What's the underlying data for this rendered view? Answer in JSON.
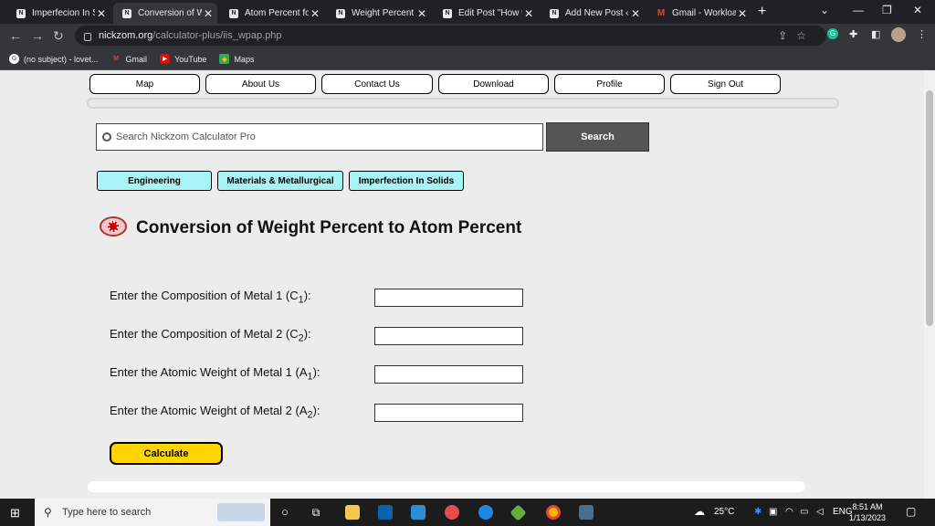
{
  "browser": {
    "tabs": [
      {
        "title": "Imperfecion In So",
        "active": false
      },
      {
        "title": "Conversion of We",
        "active": true
      },
      {
        "title": "Atom Percent for",
        "active": false
      },
      {
        "title": "Weight Percent fr",
        "active": false
      },
      {
        "title": "Edit Post \"How to",
        "active": false
      },
      {
        "title": "Add New Post ‹ N",
        "active": false
      },
      {
        "title": "Gmail - Workloac",
        "active": false
      }
    ],
    "url_host": "nickzom.org",
    "url_path": "/calculator-plus/iis_wpap.php",
    "bookmarks": [
      {
        "label": "(no subject) - lovet...",
        "icon": "google-icon"
      },
      {
        "label": "Gmail",
        "icon": "gmail-icon"
      },
      {
        "label": "YouTube",
        "icon": "youtube-icon"
      },
      {
        "label": "Maps",
        "icon": "maps-icon"
      }
    ]
  },
  "menu": [
    "Map",
    "About Us",
    "Contact Us",
    "Download",
    "Profile",
    "Sign Out"
  ],
  "search": {
    "placeholder": "Search Nickzom Calculator Pro",
    "button": "Search"
  },
  "categories": [
    "Engineering",
    "Materials & Metallurgical",
    "Imperfection In Solids"
  ],
  "page_title": "Conversion of Weight Percent to Atom Percent",
  "fields": [
    {
      "label": "Enter the Composition of Metal 1 (C",
      "sub": "1",
      "end": "):"
    },
    {
      "label": "Enter the Composition of Metal 2 (C",
      "sub": "2",
      "end": "):"
    },
    {
      "label": "Enter the Atomic Weight of Metal 1 (A",
      "sub": "1",
      "end": "):"
    },
    {
      "label": "Enter the Atomic Weight of Metal 2 (A",
      "sub": "2",
      "end": "):"
    }
  ],
  "calculate_label": "Calculate",
  "taskbar": {
    "search_placeholder": "Type here to search",
    "weather": "25°C",
    "language": "ENG",
    "time": "8:51 AM",
    "date": "1/13/2023"
  }
}
